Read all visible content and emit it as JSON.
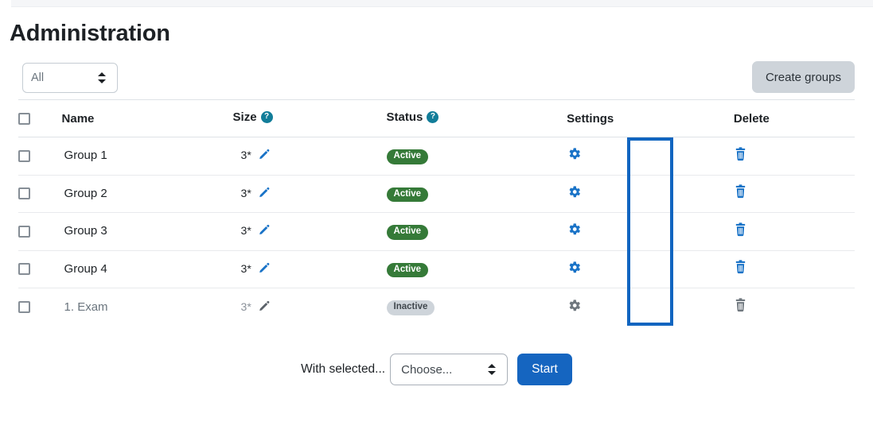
{
  "page": {
    "title": "Administration"
  },
  "toolbar": {
    "filter_value": "All",
    "create_groups_label": "Create groups"
  },
  "table": {
    "headers": {
      "select_all": "",
      "name": "Name",
      "size": "Size",
      "size_help": "?",
      "status": "Status",
      "status_help": "?",
      "settings": "Settings",
      "delete": "Delete"
    },
    "rows": [
      {
        "name": "Group 1",
        "size": "3*",
        "status": "Active",
        "status_kind": "active",
        "dimmed": false
      },
      {
        "name": "Group 2",
        "size": "3*",
        "status": "Active",
        "status_kind": "active",
        "dimmed": false
      },
      {
        "name": "Group 3",
        "size": "3*",
        "status": "Active",
        "status_kind": "active",
        "dimmed": false
      },
      {
        "name": "Group 4",
        "size": "3*",
        "status": "Active",
        "status_kind": "active",
        "dimmed": false
      },
      {
        "name": "1. Exam",
        "size": "3*",
        "status": "Inactive",
        "status_kind": "inactive",
        "dimmed": true
      }
    ]
  },
  "footer": {
    "with_selected_label": "With selected...",
    "choose_value": "Choose...",
    "start_label": "Start"
  },
  "highlight": {
    "target": "settings-column",
    "color": "#1165c0"
  },
  "colors": {
    "accent_blue": "#1565c0",
    "icon_blue": "#1a73c7",
    "active_green": "#357a38",
    "inactive_gray": "#ced4da",
    "help_teal": "#127d99",
    "highlight": "#1165c0"
  }
}
